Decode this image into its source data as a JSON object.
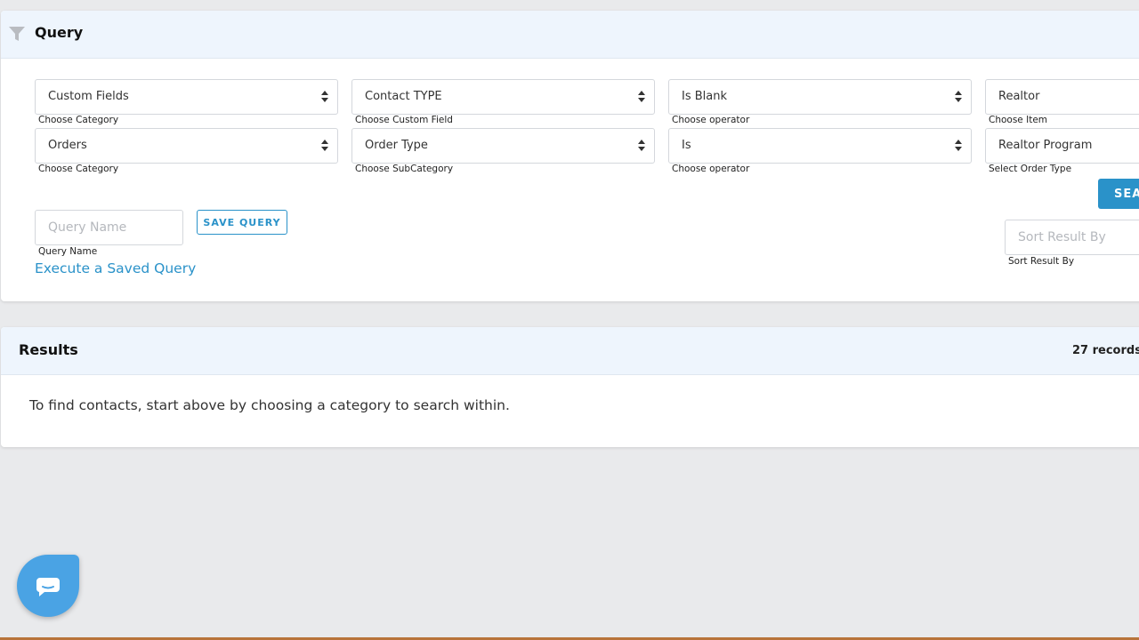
{
  "query": {
    "title": "Query",
    "rows": [
      {
        "category": {
          "value": "Custom Fields",
          "label": "Choose Category"
        },
        "field": {
          "value": "Contact TYPE",
          "label": "Choose Custom Field"
        },
        "operator": {
          "value": "Is Blank",
          "label": "Choose operator"
        },
        "item": {
          "value": "Realtor",
          "label": "Choose Item"
        }
      },
      {
        "category": {
          "value": "Orders",
          "label": "Choose Category"
        },
        "field": {
          "value": "Order Type",
          "label": "Choose SubCategory"
        },
        "operator": {
          "value": "Is",
          "label": "Choose operator"
        },
        "item": {
          "value": "Realtor Program",
          "label": "Select Order Type"
        }
      }
    ],
    "search_label": "SEA",
    "query_name": {
      "placeholder": "Query Name",
      "label": "Query Name"
    },
    "save_label": "SAVE QUERY",
    "execute_link": "Execute a Saved Query",
    "sort": {
      "placeholder": "Sort Result By",
      "label": "Sort Result By"
    }
  },
  "results": {
    "title": "Results",
    "count": "27 records",
    "message": "To find contacts, start above by choosing a category to search within."
  },
  "icons": {
    "filter": "filter-icon",
    "chat": "chat-icon"
  },
  "colors": {
    "accent": "#2a92c9",
    "header_bg": "#eef5fd",
    "chat": "#4aa3e4"
  }
}
